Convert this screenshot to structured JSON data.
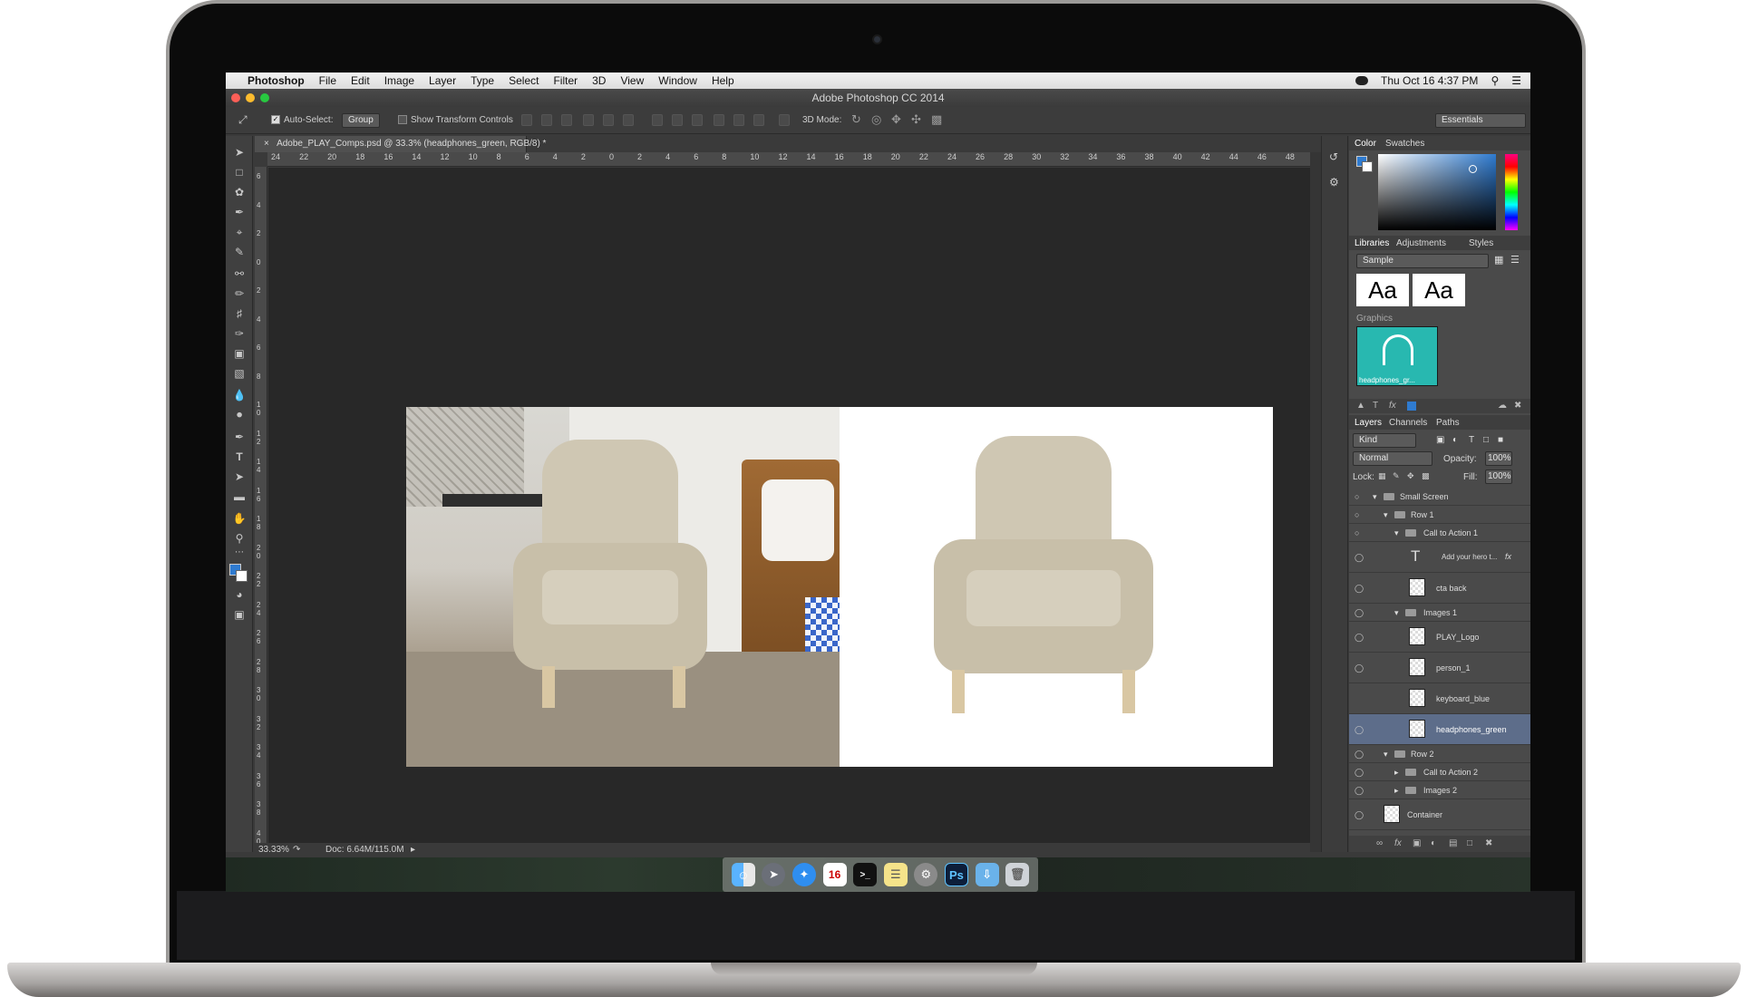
{
  "menubar": {
    "apple_glyph": "",
    "items": [
      "Photoshop",
      "File",
      "Edit",
      "Image",
      "Layer",
      "Type",
      "Select",
      "Filter",
      "3D",
      "View",
      "Window",
      "Help"
    ],
    "datetime": "Thu Oct 16  4:37 PM"
  },
  "window": {
    "title": "Adobe Photoshop CC 2014"
  },
  "options_bar": {
    "auto_select_label": "Auto-Select:",
    "auto_select_value": "Group",
    "transform_label": "Show Transform Controls",
    "mode_3d_label": "3D Mode:",
    "workspace": "Essentials"
  },
  "document": {
    "tab_title": "Adobe_PLAY_Comps.psd @ 33.3% (headphones_green, RGB/8) *",
    "ruler_h": [
      "24",
      "22",
      "20",
      "18",
      "16",
      "14",
      "12",
      "10",
      "8",
      "6",
      "4",
      "2",
      "0",
      "2",
      "4",
      "6",
      "8",
      "10",
      "12",
      "14",
      "16",
      "18",
      "20",
      "22",
      "24",
      "26",
      "28",
      "30",
      "32",
      "34",
      "36",
      "38",
      "40",
      "42",
      "44",
      "46",
      "48"
    ],
    "ruler_v": [
      "6",
      "4",
      "2",
      "0",
      "2",
      "4",
      "6",
      "8",
      "1 0",
      "1 2",
      "1 4",
      "1 6",
      "1 8",
      "2 0",
      "2 2",
      "2 4",
      "2 6",
      "2 8",
      "3 0",
      "3 2",
      "3 4",
      "3 6",
      "3 8",
      "4 0"
    ],
    "zoom": "33.33%",
    "doc_size": "Doc: 6.64M/115.0M"
  },
  "panels": {
    "color_tabs": [
      "Color",
      "Swatches"
    ],
    "library_tabs": [
      "Libraries",
      "Adjustments",
      "Styles"
    ],
    "library_select": "Sample",
    "library_char_styles": [
      "Aa",
      "Aa"
    ],
    "graphics_label": "Graphics",
    "graphic_item_label": "headphones_gr...",
    "layers_tabs": [
      "Layers",
      "Channels",
      "Paths"
    ],
    "kind_filter": "Kind",
    "blend_mode": "Normal",
    "opacity_label": "Opacity:",
    "opacity_value": "100%",
    "lock_label": "Lock:",
    "fill_label": "Fill:",
    "fill_value": "100%",
    "layers": [
      {
        "name": "Small Screen",
        "type": "group"
      },
      {
        "name": "Row 1",
        "type": "group"
      },
      {
        "name": "Call to Action 1",
        "type": "group"
      },
      {
        "name": "Add your hero t...",
        "type": "text"
      },
      {
        "name": "cta back",
        "type": "image"
      },
      {
        "name": "Images 1",
        "type": "group"
      },
      {
        "name": "PLAY_Logo",
        "type": "image"
      },
      {
        "name": "person_1",
        "type": "image"
      },
      {
        "name": "keyboard_blue",
        "type": "image"
      },
      {
        "name": "headphones_green",
        "type": "image",
        "selected": true
      },
      {
        "name": "Row 2",
        "type": "group"
      },
      {
        "name": "Call to Action 2",
        "type": "group"
      },
      {
        "name": "Images 2",
        "type": "group"
      },
      {
        "name": "Container",
        "type": "image"
      }
    ]
  },
  "dock": {
    "calendar_day": "16",
    "ps_label": "Ps",
    "icons": [
      "finder-icon",
      "launchpad-icon",
      "safari-icon",
      "calendar-icon",
      "terminal-icon",
      "notes-icon",
      "system-preferences-icon",
      "photoshop-icon",
      "downloads-folder-icon",
      "trash-icon"
    ]
  },
  "colors": {
    "foreground": "#2f7bd0",
    "background": "#ffffff",
    "selected_layer": "#5d6d8a",
    "graphic_tile": "#28b8b0"
  }
}
